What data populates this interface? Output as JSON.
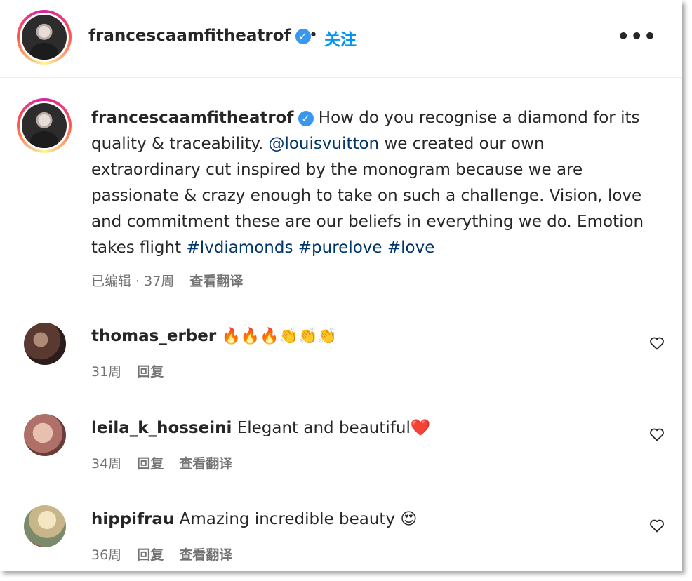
{
  "post": {
    "author": "francescaamfitheatrof",
    "separator": "•",
    "follow_label": "关注",
    "more_label": "•••"
  },
  "caption": {
    "author": "francescaamfitheatrof",
    "text_1": " How do you recognise a diamond for its quality & traceability. ",
    "mention": "@louisvuitton",
    "text_2": " we created our own extraordinary cut inspired by the monogram because we are passionate & crazy enough to take on such a challenge. Vision, love and commitment these are our beliefs in everything we do. Emotion takes flight ",
    "hashtags": [
      "#lvdiamonds",
      "#purelove",
      "#love"
    ],
    "edited_label": "已编辑 · 37周",
    "translate_label": "查看翻译"
  },
  "comments": [
    {
      "user": "thomas_erber",
      "text": "🔥🔥🔥👏👏👏",
      "time": "31周",
      "reply_label": "回复",
      "translate_label": ""
    },
    {
      "user": "leila_k_hosseini",
      "text": "Elegant and beautiful❤️",
      "time": "34周",
      "reply_label": "回复",
      "translate_label": "查看翻译"
    },
    {
      "user": "hippifrau",
      "text": "Amazing incredible beauty 😍",
      "time": "36周",
      "reply_label": "回复",
      "translate_label": "查看翻译"
    }
  ],
  "icons": {
    "verified": "verified-badge-icon",
    "heart": "heart-outline-icon",
    "more": "more-horizontal-icon"
  },
  "colors": {
    "link": "#00376b",
    "follow": "#0095f6",
    "verified": "#3897f0",
    "meta": "#737373"
  }
}
